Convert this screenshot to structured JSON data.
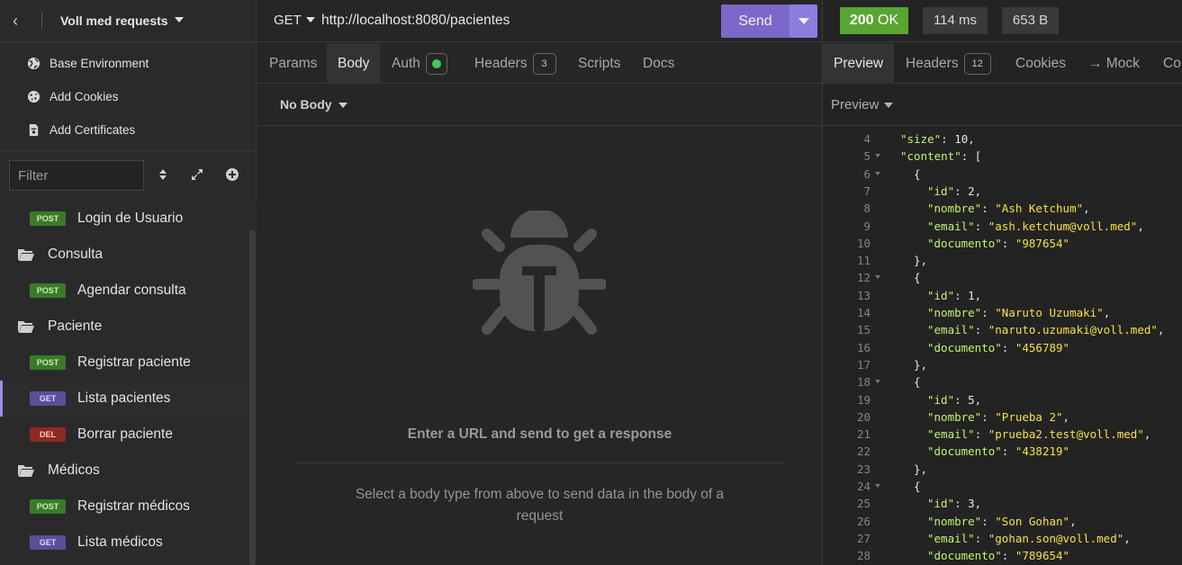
{
  "sidebar": {
    "project_name": "Voll med requests",
    "env_items": [
      {
        "label": "Base Environment"
      },
      {
        "label": "Add Cookies"
      },
      {
        "label": "Add Certificates"
      }
    ],
    "filter_placeholder": "Filter",
    "tree": [
      {
        "kind": "request",
        "method": "POST",
        "label": "Login de Usuario"
      },
      {
        "kind": "folder",
        "label": "Consulta"
      },
      {
        "kind": "request",
        "method": "POST",
        "label": "Agendar consulta"
      },
      {
        "kind": "folder",
        "label": "Paciente"
      },
      {
        "kind": "request",
        "method": "POST",
        "label": "Registrar paciente"
      },
      {
        "kind": "request",
        "method": "GET",
        "label": "Lista pacientes",
        "active": true
      },
      {
        "kind": "request",
        "method": "DEL",
        "label": "Borrar paciente"
      },
      {
        "kind": "folder",
        "label": "Médicos"
      },
      {
        "kind": "request",
        "method": "POST",
        "label": "Registrar médicos"
      },
      {
        "kind": "request",
        "method": "GET",
        "label": "Lista médicos"
      }
    ]
  },
  "request": {
    "method": "GET",
    "url": "http://localhost:8080/pacientes",
    "send_label": "Send",
    "tabs": {
      "params": "Params",
      "body": "Body",
      "auth": "Auth",
      "headers": "Headers",
      "headers_count": "3",
      "scripts": "Scripts",
      "docs": "Docs"
    },
    "body_type": "No Body",
    "empty_title": "Enter a URL and send to get a response",
    "empty_desc": "Select a body type from above to send data in the body of a request"
  },
  "response": {
    "status": "200",
    "status_text": "OK",
    "time": "114 ms",
    "size": "653 B",
    "tabs": {
      "preview": "Preview",
      "headers": "Headers",
      "headers_count": "12",
      "cookies": "Cookies",
      "mock": "→ Mock",
      "console": "Co"
    },
    "preview_mode": "Preview",
    "code_lines": [
      {
        "n": "4",
        "fold": false,
        "indent": 0,
        "tokens": [
          [
            "k",
            "\"size\""
          ],
          [
            "n",
            ": "
          ],
          [
            "n",
            "10"
          ],
          [
            "n",
            ","
          ]
        ]
      },
      {
        "n": "5",
        "fold": true,
        "indent": 0,
        "tokens": [
          [
            "k",
            "\"content\""
          ],
          [
            "n",
            ": ["
          ]
        ]
      },
      {
        "n": "6",
        "fold": true,
        "indent": 1,
        "tokens": [
          [
            "n",
            "{"
          ]
        ]
      },
      {
        "n": "7",
        "fold": false,
        "indent": 2,
        "tokens": [
          [
            "k",
            "\"id\""
          ],
          [
            "n",
            ": 2,"
          ]
        ]
      },
      {
        "n": "8",
        "fold": false,
        "indent": 2,
        "tokens": [
          [
            "k",
            "\"nombre\""
          ],
          [
            "n",
            ": "
          ],
          [
            "s",
            "\"Ash Ketchum\""
          ],
          [
            "n",
            ","
          ]
        ]
      },
      {
        "n": "9",
        "fold": false,
        "indent": 2,
        "tokens": [
          [
            "k",
            "\"email\""
          ],
          [
            "n",
            ": "
          ],
          [
            "s",
            "\"ash.ketchum@voll.med\""
          ],
          [
            "n",
            ","
          ]
        ]
      },
      {
        "n": "10",
        "fold": false,
        "indent": 2,
        "tokens": [
          [
            "k",
            "\"documento\""
          ],
          [
            "n",
            ": "
          ],
          [
            "s",
            "\"987654\""
          ]
        ]
      },
      {
        "n": "11",
        "fold": false,
        "indent": 1,
        "tokens": [
          [
            "n",
            "},"
          ]
        ]
      },
      {
        "n": "12",
        "fold": true,
        "indent": 1,
        "tokens": [
          [
            "n",
            "{"
          ]
        ]
      },
      {
        "n": "13",
        "fold": false,
        "indent": 2,
        "tokens": [
          [
            "k",
            "\"id\""
          ],
          [
            "n",
            ": 1,"
          ]
        ]
      },
      {
        "n": "14",
        "fold": false,
        "indent": 2,
        "tokens": [
          [
            "k",
            "\"nombre\""
          ],
          [
            "n",
            ": "
          ],
          [
            "s",
            "\"Naruto Uzumaki\""
          ],
          [
            "n",
            ","
          ]
        ]
      },
      {
        "n": "15",
        "fold": false,
        "indent": 2,
        "tokens": [
          [
            "k",
            "\"email\""
          ],
          [
            "n",
            ": "
          ],
          [
            "s",
            "\"naruto.uzumaki@voll.med\""
          ],
          [
            "n",
            ","
          ]
        ]
      },
      {
        "n": "16",
        "fold": false,
        "indent": 2,
        "tokens": [
          [
            "k",
            "\"documento\""
          ],
          [
            "n",
            ": "
          ],
          [
            "s",
            "\"456789\""
          ]
        ]
      },
      {
        "n": "17",
        "fold": false,
        "indent": 1,
        "tokens": [
          [
            "n",
            "},"
          ]
        ]
      },
      {
        "n": "18",
        "fold": true,
        "indent": 1,
        "tokens": [
          [
            "n",
            "{"
          ]
        ]
      },
      {
        "n": "19",
        "fold": false,
        "indent": 2,
        "tokens": [
          [
            "k",
            "\"id\""
          ],
          [
            "n",
            ": 5,"
          ]
        ]
      },
      {
        "n": "20",
        "fold": false,
        "indent": 2,
        "tokens": [
          [
            "k",
            "\"nombre\""
          ],
          [
            "n",
            ": "
          ],
          [
            "s",
            "\"Prueba 2\""
          ],
          [
            "n",
            ","
          ]
        ]
      },
      {
        "n": "21",
        "fold": false,
        "indent": 2,
        "tokens": [
          [
            "k",
            "\"email\""
          ],
          [
            "n",
            ": "
          ],
          [
            "s",
            "\"prueba2.test@voll.med\""
          ],
          [
            "n",
            ","
          ]
        ]
      },
      {
        "n": "22",
        "fold": false,
        "indent": 2,
        "tokens": [
          [
            "k",
            "\"documento\""
          ],
          [
            "n",
            ": "
          ],
          [
            "s",
            "\"438219\""
          ]
        ]
      },
      {
        "n": "23",
        "fold": false,
        "indent": 1,
        "tokens": [
          [
            "n",
            "},"
          ]
        ]
      },
      {
        "n": "24",
        "fold": true,
        "indent": 1,
        "tokens": [
          [
            "n",
            "{"
          ]
        ]
      },
      {
        "n": "25",
        "fold": false,
        "indent": 2,
        "tokens": [
          [
            "k",
            "\"id\""
          ],
          [
            "n",
            ": 3,"
          ]
        ]
      },
      {
        "n": "26",
        "fold": false,
        "indent": 2,
        "tokens": [
          [
            "k",
            "\"nombre\""
          ],
          [
            "n",
            ": "
          ],
          [
            "s",
            "\"Son Gohan\""
          ],
          [
            "n",
            ","
          ]
        ]
      },
      {
        "n": "27",
        "fold": false,
        "indent": 2,
        "tokens": [
          [
            "k",
            "\"email\""
          ],
          [
            "n",
            ": "
          ],
          [
            "s",
            "\"gohan.son@voll.med\""
          ],
          [
            "n",
            ","
          ]
        ]
      },
      {
        "n": "28",
        "fold": false,
        "indent": 2,
        "tokens": [
          [
            "k",
            "\"documento\""
          ],
          [
            "n",
            ": "
          ],
          [
            "s",
            "\"789654\""
          ]
        ]
      }
    ]
  },
  "colors": {
    "accent": "#7b68c8",
    "success": "#5aa532",
    "json_key": "#c4f26e",
    "json_string": "#f5e04a"
  }
}
